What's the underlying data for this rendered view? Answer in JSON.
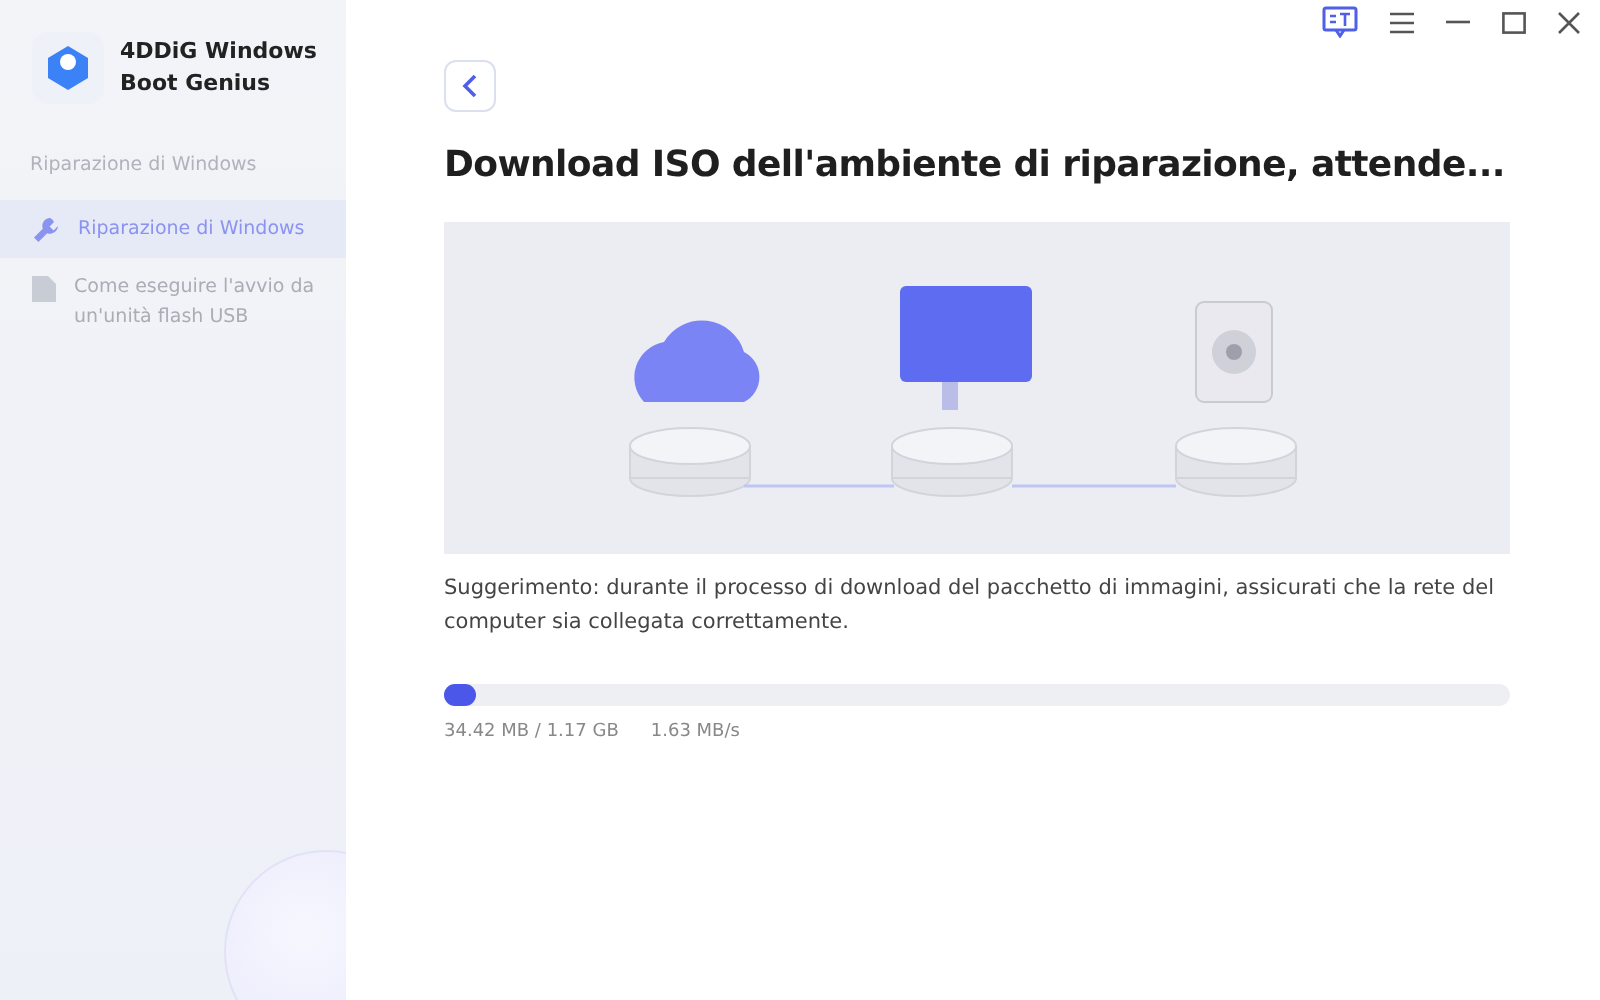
{
  "app": {
    "name": "4DDiG Windows Boot Genius"
  },
  "sidebar": {
    "section": "Riparazione di Windows",
    "items": [
      {
        "label": "Riparazione di Windows",
        "selected": true,
        "kind": "wrench"
      },
      {
        "label": "Come eseguire l'avvio da un'unità flash USB",
        "selected": false,
        "kind": "document"
      }
    ]
  },
  "title": "Download ISO dell'ambiente di riparazione, attende...",
  "tip": "Suggerimento: durante il processo di download del pacchetto di immagini, assicurati che la rete del computer sia collegata correttamente.",
  "progress": {
    "level": 0.03,
    "size": "34.42 MB / 1.17 GB",
    "speed": "1.63 MB/s"
  }
}
